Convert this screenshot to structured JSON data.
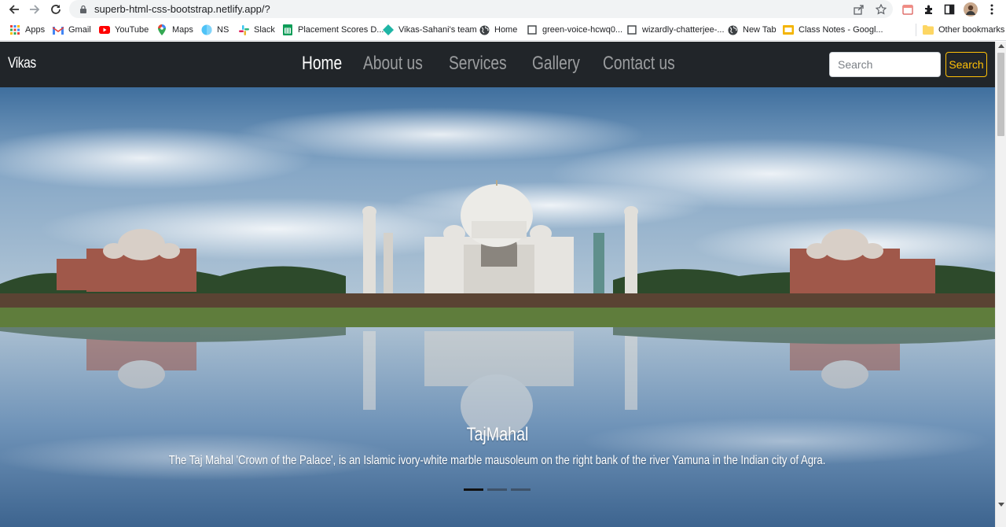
{
  "browser": {
    "url": "superb-html-css-bootstrap.netlify.app/?",
    "bookmarks": [
      {
        "label": "Apps",
        "icon": "apps-grid-icon"
      },
      {
        "label": "Gmail",
        "icon": "gmail-icon"
      },
      {
        "label": "YouTube",
        "icon": "youtube-icon"
      },
      {
        "label": "Maps",
        "icon": "maps-icon"
      },
      {
        "label": "NS",
        "icon": "ns-icon"
      },
      {
        "label": "Slack",
        "icon": "slack-icon"
      },
      {
        "label": "Placement Scores D...",
        "icon": "sheets-icon"
      },
      {
        "label": "Vikas-Sahani's team",
        "icon": "diamond-icon"
      },
      {
        "label": "Home",
        "icon": "globe-icon"
      },
      {
        "label": "green-voice-hcwq0...",
        "icon": "page-icon"
      },
      {
        "label": "wizardly-chatterjee-...",
        "icon": "page-icon"
      },
      {
        "label": "New Tab",
        "icon": "globe-icon"
      },
      {
        "label": "Class Notes - Googl...",
        "icon": "slides-icon"
      }
    ],
    "other_bookmarks": "Other bookmarks"
  },
  "navbar": {
    "brand": "Vikas",
    "links": [
      {
        "label": "Home",
        "active": true
      },
      {
        "label": "About us",
        "active": false
      },
      {
        "label": "Services",
        "active": false
      },
      {
        "label": "Gallery",
        "active": false
      },
      {
        "label": "Contact us",
        "active": false
      }
    ],
    "search_placeholder": "Search",
    "search_button": "Search"
  },
  "carousel": {
    "title": "TajMahal",
    "text": "The Taj Mahal 'Crown of the Palace', is an Islamic ivory-white marble mausoleum on the right bank of the river Yamuna in the Indian city of Agra.",
    "slides": 3,
    "active_slide": 1
  }
}
